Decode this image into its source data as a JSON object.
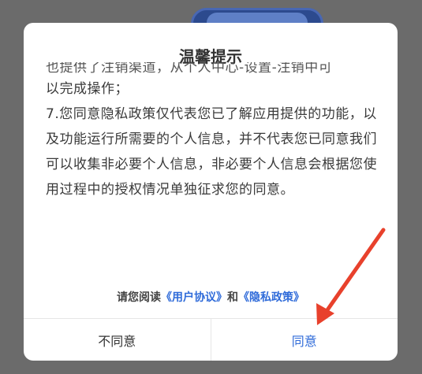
{
  "dialog": {
    "title": "温馨提示",
    "paragraphs": [
      "也提供了注销渠道，从个人中心-设置-注销中可",
      "以完成操作；",
      "7.您同意隐私政策仅代表您已了解应用提供的功能，以及功能运行所需要的个人信息，并不代表您已同意我们可以收集非必要个人信息，非必要个人信息会根据您使用过程中的授权情况单独征求您的同意。"
    ],
    "agreement": {
      "prefix": "请您阅读",
      "user_agreement": "《用户协议》",
      "and": "和",
      "privacy_policy": "《隐私政策》"
    },
    "buttons": {
      "disagree": "不同意",
      "agree": "同意"
    }
  },
  "annotation": {
    "arrow_color": "#e8412c"
  }
}
